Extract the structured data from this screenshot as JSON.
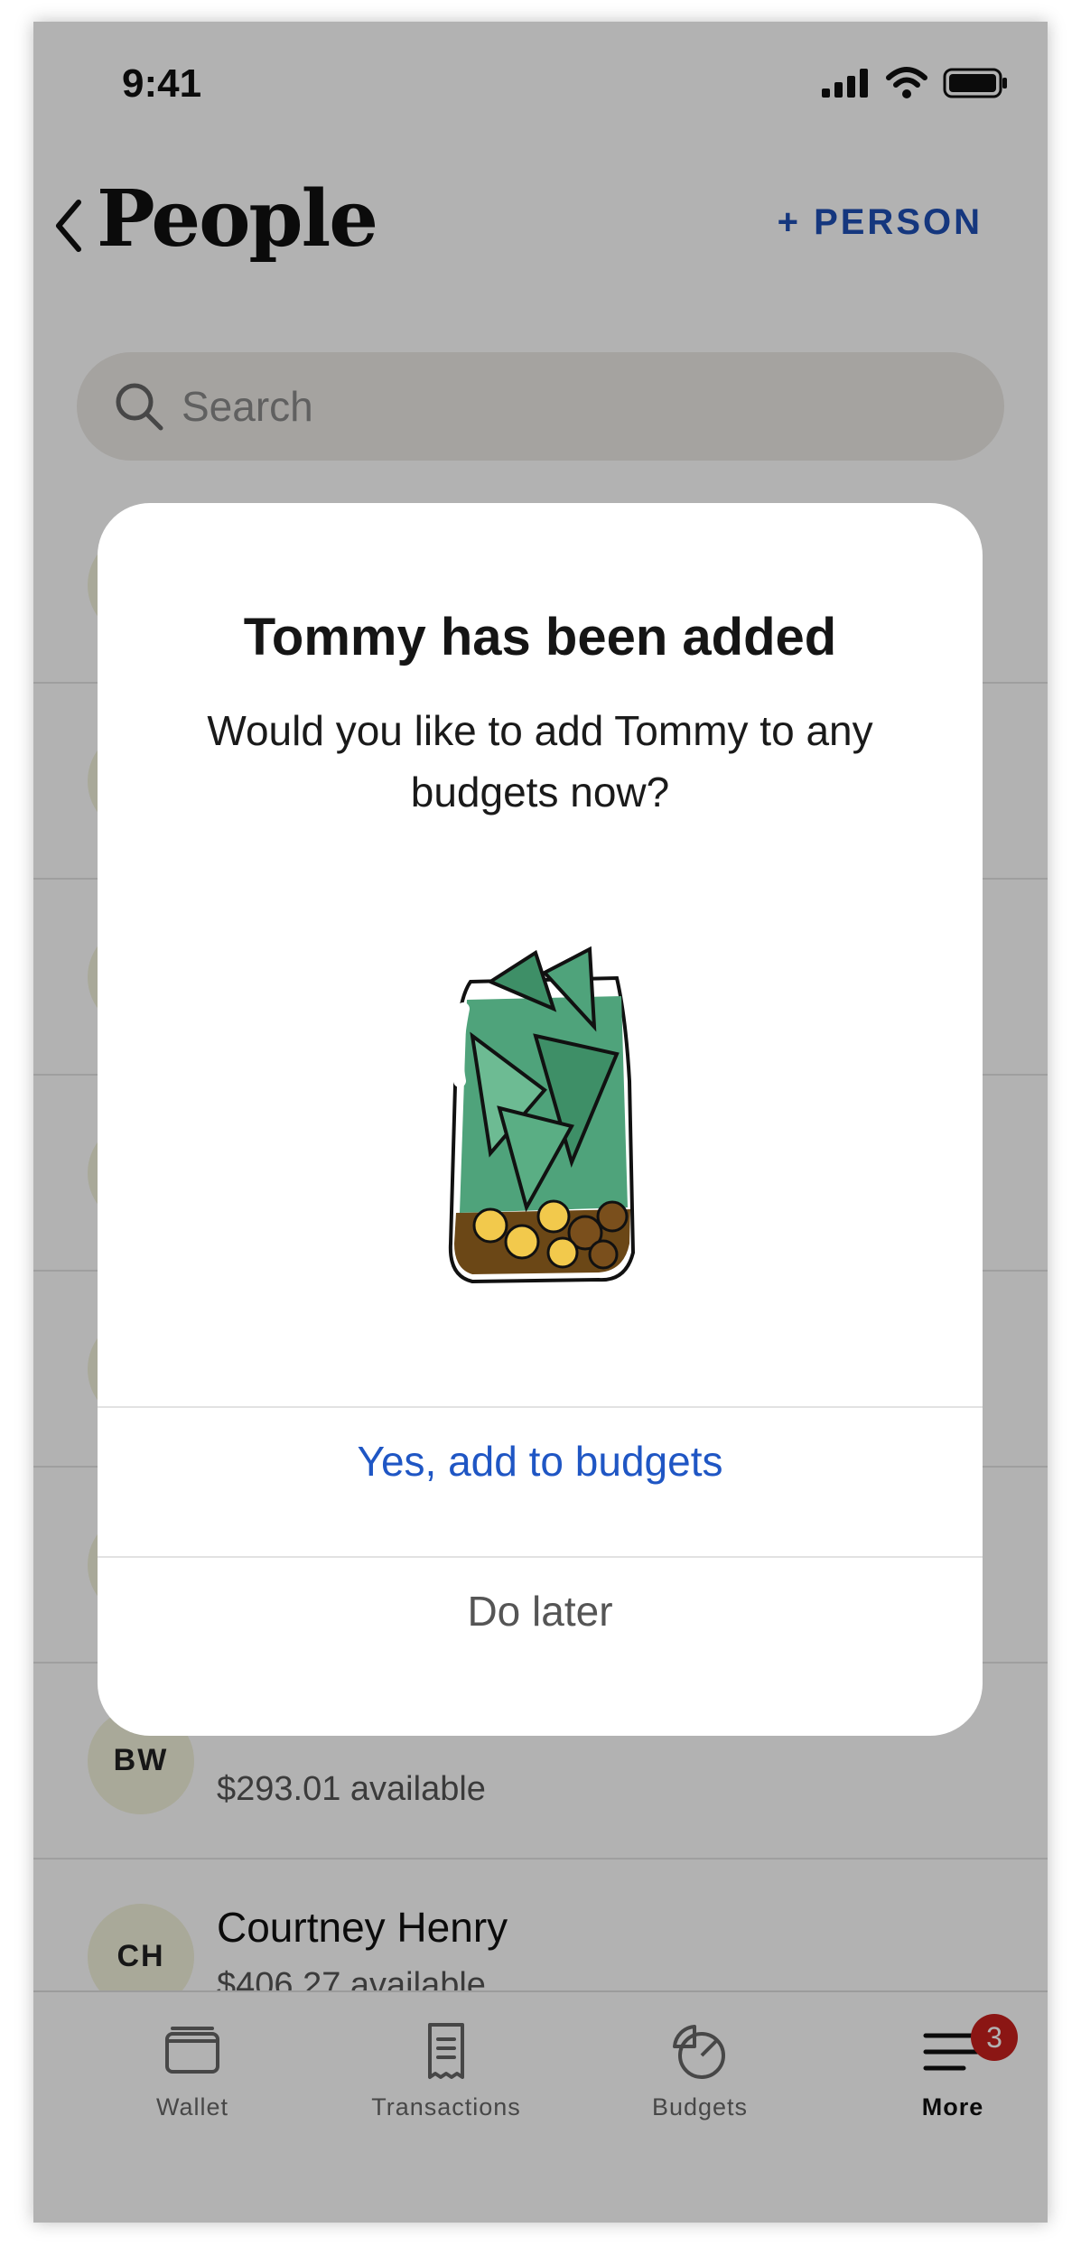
{
  "status_bar": {
    "time": "9:41"
  },
  "header": {
    "title": "People",
    "add_person_label": "+ PERSON"
  },
  "search": {
    "placeholder": "Search"
  },
  "people": [
    {
      "initials": "",
      "name": "",
      "available": ""
    },
    {
      "initials": "",
      "name": "",
      "available": ""
    },
    {
      "initials": "",
      "name": "",
      "available": ""
    },
    {
      "initials": "",
      "name": "",
      "available": ""
    },
    {
      "initials": "",
      "name": "",
      "available": ""
    },
    {
      "initials": "",
      "name": "",
      "available": ""
    },
    {
      "initials": "BW",
      "name": "",
      "available": "$293.01 available"
    },
    {
      "initials": "CH",
      "name": "Courtney Henry",
      "available": "$406.27 available"
    }
  ],
  "tabs": [
    {
      "label": "Wallet",
      "icon": "wallet-icon"
    },
    {
      "label": "Transactions",
      "icon": "receipt-icon"
    },
    {
      "label": "Budgets",
      "icon": "pie-chart-icon"
    },
    {
      "label": "More",
      "icon": "menu-icon",
      "badge": "3",
      "active": true
    }
  ],
  "modal": {
    "title": "Tommy has been added",
    "body": "Would you like to add Tommy to any budgets now?",
    "illustration": "money-jar-illustration",
    "primary_button": "Yes, add to budgets",
    "secondary_button": "Do later"
  },
  "colors": {
    "accent_blue": "#1f56c4",
    "badge_red": "#c8201e",
    "avatar_bg": "#f3f2dc",
    "money_green": "#4fa37b"
  }
}
